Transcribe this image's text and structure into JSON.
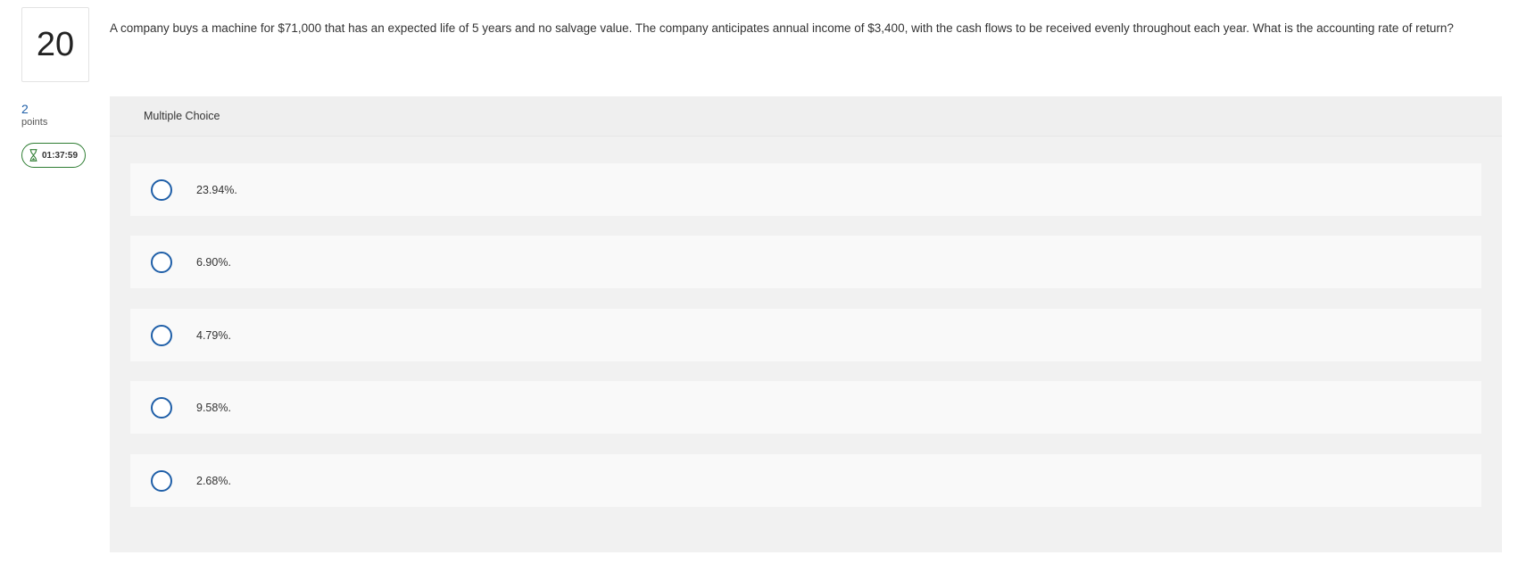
{
  "question": {
    "number": "20",
    "text": "A company buys a machine for $71,000 that has an expected life of 5 years and no salvage value. The company anticipates annual  income of $3,400, with the cash flows to be received evenly throughout each year. What is the accounting rate of return?"
  },
  "points": {
    "value": "2",
    "label": "points"
  },
  "timer": {
    "icon": "hourglass-icon",
    "value": "01:37:59",
    "color": "#2e7d32"
  },
  "answer_panel": {
    "title": "Multiple Choice",
    "options": [
      {
        "label": "23.94%."
      },
      {
        "label": "6.90%."
      },
      {
        "label": "4.79%."
      },
      {
        "label": "9.58%."
      },
      {
        "label": "2.68%."
      }
    ]
  },
  "colors": {
    "accent": "#1f5fa8",
    "panel_bg": "#f1f1f1",
    "option_bg": "#f9f9f9"
  }
}
